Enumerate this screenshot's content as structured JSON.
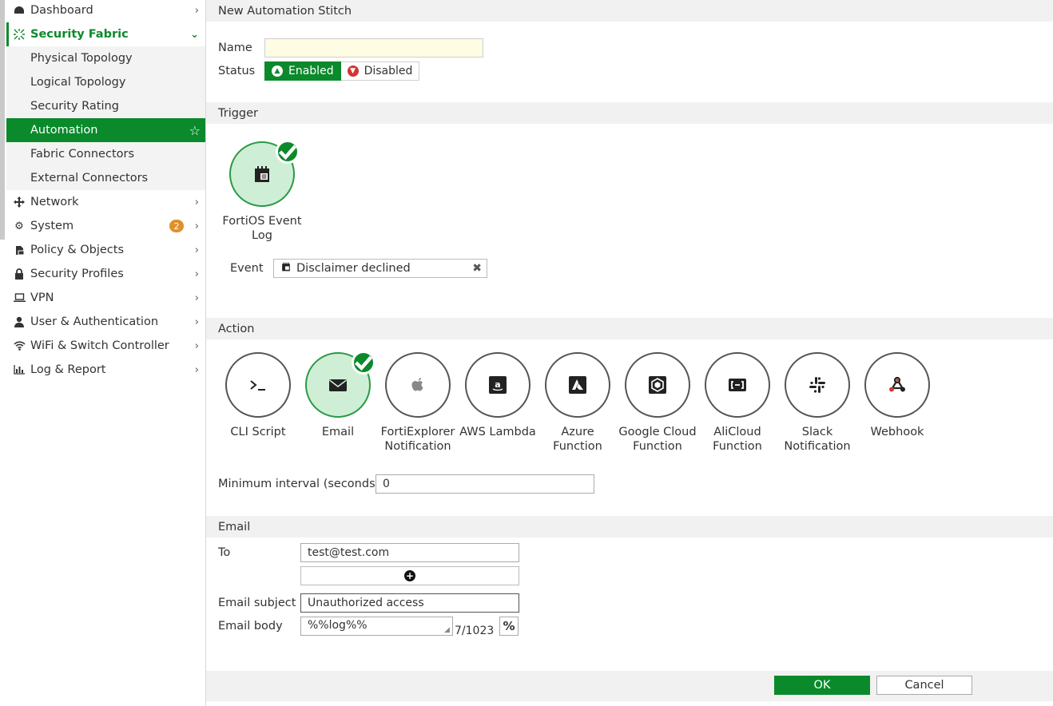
{
  "sidebar": {
    "items": [
      {
        "label": "Dashboard",
        "icon": "dashboard-icon"
      },
      {
        "label": "Security Fabric",
        "icon": "security-fabric-icon"
      },
      {
        "label": "Physical Topology"
      },
      {
        "label": "Logical Topology"
      },
      {
        "label": "Security Rating"
      },
      {
        "label": "Automation"
      },
      {
        "label": "Fabric Connectors"
      },
      {
        "label": "External Connectors"
      },
      {
        "label": "Network",
        "icon": "network-icon"
      },
      {
        "label": "System",
        "icon": "gear-icon",
        "badge": "2"
      },
      {
        "label": "Policy & Objects",
        "icon": "policy-icon"
      },
      {
        "label": "Security Profiles",
        "icon": "lock-icon"
      },
      {
        "label": "VPN",
        "icon": "laptop-icon"
      },
      {
        "label": "User & Authentication",
        "icon": "user-icon"
      },
      {
        "label": "WiFi & Switch Controller",
        "icon": "wifi-icon"
      },
      {
        "label": "Log & Report",
        "icon": "chart-icon"
      }
    ]
  },
  "page": {
    "title": "New Automation Stitch",
    "name_label": "Name",
    "name_value": "",
    "status_label": "Status",
    "status_enabled": "Enabled",
    "status_disabled": "Disabled"
  },
  "trigger": {
    "header": "Trigger",
    "card_caption_line1": "FortiOS Event",
    "card_caption_line2": "Log",
    "event_label": "Event",
    "event_value": "Disclaimer declined"
  },
  "action": {
    "header": "Action",
    "cards": [
      {
        "line1": "CLI Script",
        "line2": ""
      },
      {
        "line1": "Email",
        "line2": ""
      },
      {
        "line1": "FortiExplorer",
        "line2": "Notification"
      },
      {
        "line1": "AWS Lambda",
        "line2": ""
      },
      {
        "line1": "Azure",
        "line2": "Function"
      },
      {
        "line1": "Google Cloud",
        "line2": "Function"
      },
      {
        "line1": "AliCloud",
        "line2": "Function"
      },
      {
        "line1": "Slack",
        "line2": "Notification"
      },
      {
        "line1": "Webhook",
        "line2": ""
      }
    ],
    "selected": "Email",
    "min_interval_label": "Minimum interval (seconds)",
    "min_interval_value": "0"
  },
  "email": {
    "header": "Email",
    "to_label": "To",
    "to_value": "test@test.com",
    "subject_label": "Email subject",
    "subject_value": "Unauthorized access",
    "body_label": "Email body",
    "body_value": "%%log%%",
    "counter": "7/1023",
    "percent_label": "%"
  },
  "footer": {
    "ok_label": "OK",
    "cancel_label": "Cancel"
  },
  "colors": {
    "accent": "#0a8a2b",
    "selected_fill": "#cfeed6",
    "badge": "#e0902a",
    "name_field_bg": "#fefce3"
  }
}
